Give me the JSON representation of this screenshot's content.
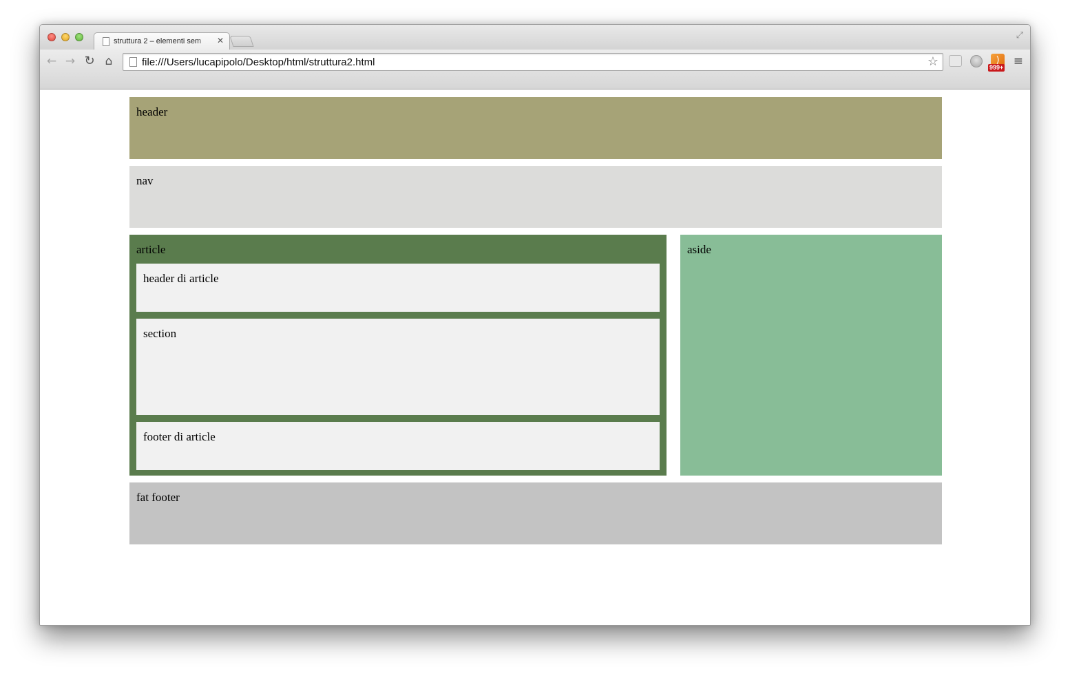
{
  "browser": {
    "tab_title": "struttura 2 – elementi sem",
    "tab_close_glyph": "✕",
    "address": "file:///Users/lucapipolo/Desktop/html/struttura2.html",
    "rss_badge": "999+",
    "icons": {
      "back": "←",
      "forward": "→",
      "reload": "↻",
      "home": "⌂",
      "star": "☆",
      "menu": "≡",
      "fullscreen": "⤢",
      "rss": ")"
    }
  },
  "page": {
    "header": "header",
    "nav": "nav",
    "article": {
      "label": "article",
      "header": "header di article",
      "section": "section",
      "footer": "footer di article"
    },
    "aside": "aside",
    "fat_footer": "fat footer"
  },
  "colors": {
    "header": "#a6a377",
    "nav": "#dcdcda",
    "article": "#5a7c4d",
    "article_inner": "#f1f1f1",
    "aside": "#88bd97",
    "fat_footer": "#c3c3c3"
  }
}
